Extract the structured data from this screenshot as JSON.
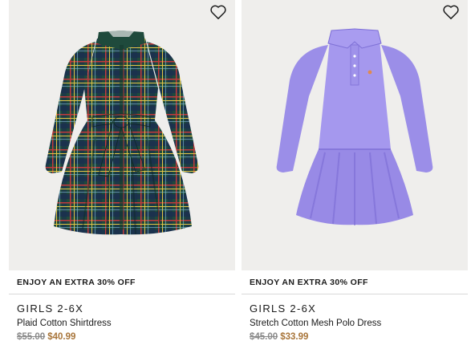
{
  "products": [
    {
      "promo": "ENJOY AN EXTRA 30% OFF",
      "category": "GIRLS 2-6X",
      "name": "Plaid Cotton Shirtdress",
      "original_price": "$55.00",
      "sale_price": "$40.99",
      "image_icon": "plaid-shirtdress-image",
      "wishlist_icon": "heart-icon"
    },
    {
      "promo": "ENJOY AN EXTRA 30% OFF",
      "category": "GIRLS 2-6X",
      "name": "Stretch Cotton Mesh Polo Dress",
      "original_price": "$45.00",
      "sale_price": "$33.99",
      "image_icon": "polo-dress-image",
      "wishlist_icon": "heart-icon"
    }
  ],
  "colors": {
    "image_bg": "#efeeec",
    "sale_price": "#a8753a",
    "was_price": "#8a8a8a",
    "plaid_green": "#1f4a3c",
    "polo_lavender": "#9b8ee8"
  }
}
